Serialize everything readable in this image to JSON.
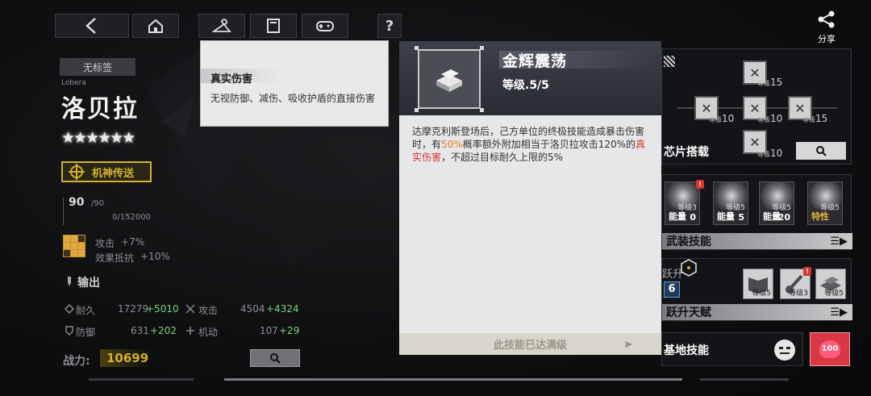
{
  "nav": {
    "share_label": "分享"
  },
  "character": {
    "tag": "无标签",
    "name_en": "Lobera",
    "name": "洛贝拉",
    "stars": "★★★★★★",
    "mech_label": "机神传送",
    "level": "90",
    "level_max": "/90",
    "exp": "0/152000",
    "bonus": [
      {
        "label": "攻击",
        "value": "+7%"
      },
      {
        "label": "效果抵抗",
        "value": "+10%"
      }
    ],
    "role": "输出",
    "stats": [
      {
        "label": "耐久",
        "base": "17279",
        "bonus": "+5010"
      },
      {
        "label": "攻击",
        "base": "4504",
        "bonus": "+4324"
      },
      {
        "label": "防御",
        "base": "631",
        "bonus": "+202"
      },
      {
        "label": "机动",
        "base": "107",
        "bonus": "+29"
      }
    ],
    "power_label": "战力:",
    "power": "10699"
  },
  "tooltip": {
    "title": "真实伤害",
    "desc": "无视防御、减伤、吸收护盾的直接伤害"
  },
  "skill": {
    "name": "金辉震荡",
    "level": "等级.5/5",
    "desc_1": "达摩克利斯登场后，己方单位的终极技能造成暴击伤害时，有",
    "desc_pct": "50%",
    "desc_2": "概率额外附加相当于洛贝拉攻击120%的",
    "desc_true": "真实伤害",
    "desc_3": "，不超过目标耐久上限的5%",
    "max_label": "此技能已达满级"
  },
  "chips": {
    "title": "芯片搭载",
    "levels": [
      "15",
      "10",
      "10",
      "15",
      "10"
    ],
    "level_prefix": "等级"
  },
  "weapon_skills": {
    "title": "武装技能",
    "level_prefix": "等级",
    "tiles": [
      {
        "label": "能量",
        "cost": "0",
        "level": "3",
        "alert": "!"
      },
      {
        "label": "能量",
        "cost": "5",
        "level": "5"
      },
      {
        "label": "能量",
        "cost": "20",
        "level": "5"
      },
      {
        "label": "特性",
        "cost": "",
        "level": "5"
      }
    ]
  },
  "ascend": {
    "label": "跃升",
    "count": "6",
    "title": "跃升天赋",
    "level_prefix": "等级",
    "tiles": [
      {
        "level": "5"
      },
      {
        "level": "3",
        "alert": "!"
      },
      {
        "level": "5"
      }
    ]
  },
  "base": {
    "title": "基地技能",
    "badge": "100"
  },
  "colors": {
    "accent_gold": "#d4b030",
    "orange": "#e0822a",
    "red": "#d93a2e",
    "green": "#7bd27b"
  }
}
